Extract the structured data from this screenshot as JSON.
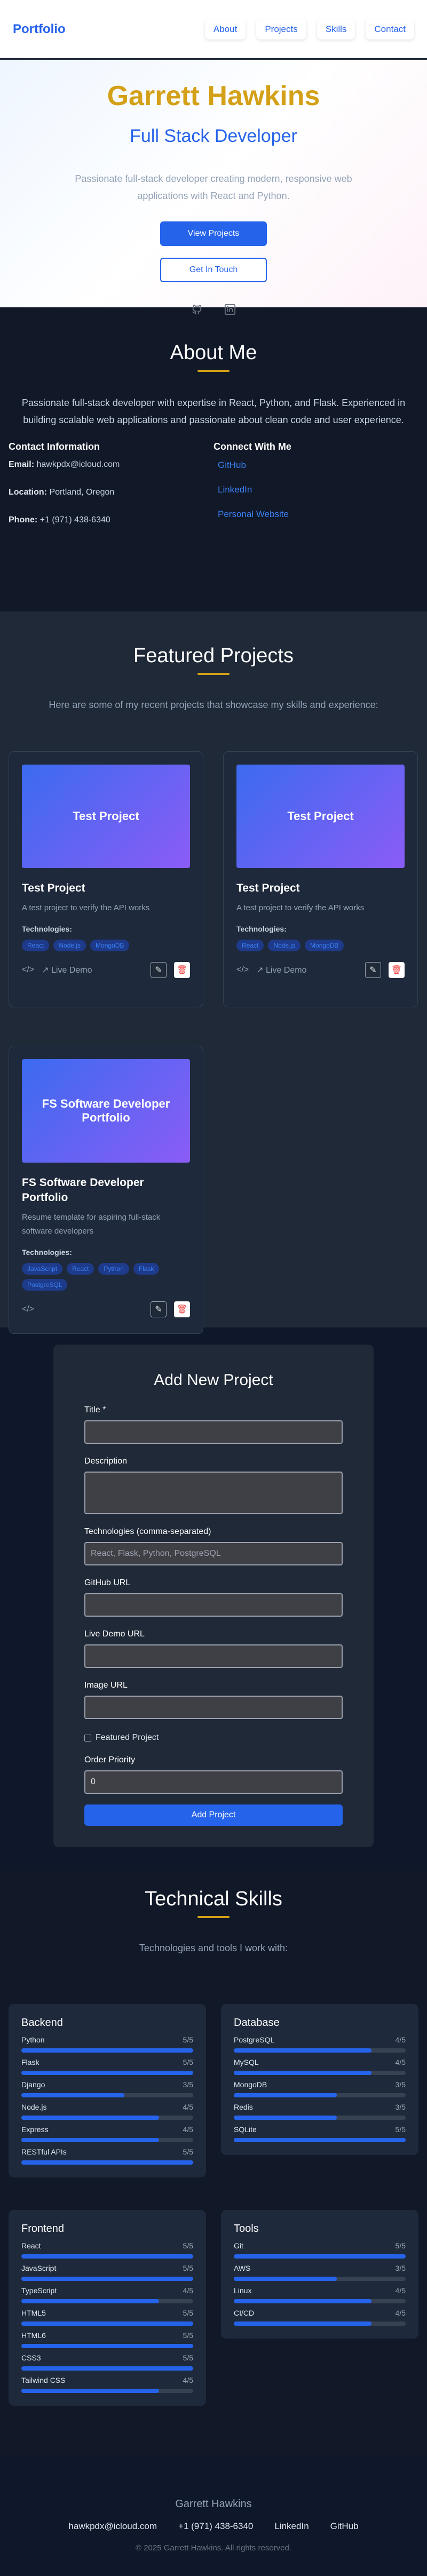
{
  "nav": {
    "logo": "Portfolio",
    "links": [
      "About",
      "Projects",
      "Skills",
      "Contact"
    ]
  },
  "hero": {
    "name": "Garrett Hawkins",
    "role": "Full Stack Developer",
    "tagline": "Passionate full-stack developer creating modern, responsive web applications with React and Python.",
    "view_projects": "View Projects",
    "get_in_touch": "Get In Touch"
  },
  "about": {
    "title": "About Me",
    "lead": "Passionate full-stack developer with expertise in React, Python, and Flask. Experienced in building scalable web applications and passionate about clean code and user experience.",
    "contact_title": "Contact Information",
    "email_label": "Email:",
    "email": "hawkpdx@icloud.com",
    "location_label": "Location:",
    "location": "Portland, Oregon",
    "phone_label": "Phone:",
    "phone": "+1 (971) 438-6340",
    "connect_title": "Connect With Me",
    "connect_links": [
      "GitHub",
      "LinkedIn",
      "Personal Website"
    ]
  },
  "projects": {
    "title": "Featured Projects",
    "subtitle": "Here are some of my recent projects that showcase my skills and experience:",
    "tech_label": "Technologies:",
    "live_demo": "Live Demo",
    "items": [
      {
        "thumb": "Test Project",
        "title": "Test Project",
        "desc": "A test project to verify the API works",
        "tags": [
          "React",
          "Node.js",
          "MongoDB"
        ]
      },
      {
        "thumb": "Test Project",
        "title": "Test Project",
        "desc": "A test project to verify the API works",
        "tags": [
          "React",
          "Node.js",
          "MongoDB"
        ]
      },
      {
        "thumb": "FS Software Developer Portfolio",
        "title": "FS Software Developer Portfolio",
        "desc": "Resume template for aspiring full-stack software developers",
        "tags": [
          "JavaScript",
          "React",
          "Python",
          "Flask",
          "PostgreSQL"
        ]
      }
    ]
  },
  "form": {
    "title": "Add New Project",
    "title_label": "Title *",
    "desc_label": "Description",
    "tech_label": "Technologies (comma-separated)",
    "tech_placeholder": "React, Flask, Python, PostgreSQL",
    "github_label": "GitHub URL",
    "demo_label": "Live Demo URL",
    "image_label": "Image URL",
    "featured_label": "Featured Project",
    "order_label": "Order Priority",
    "order_value": "0",
    "submit": "Add Project"
  },
  "skills": {
    "title": "Technical Skills",
    "subtitle": "Technologies and tools I work with:",
    "groups": [
      {
        "name": "Backend",
        "items": [
          {
            "name": "Python",
            "level": "5/5",
            "value": 5
          },
          {
            "name": "Flask",
            "level": "5/5",
            "value": 5
          },
          {
            "name": "Django",
            "level": "3/5",
            "value": 3
          },
          {
            "name": "Node.js",
            "level": "4/5",
            "value": 4
          },
          {
            "name": "Express",
            "level": "4/5",
            "value": 4
          },
          {
            "name": "RESTful APIs",
            "level": "5/5",
            "value": 5
          }
        ]
      },
      {
        "name": "Database",
        "items": [
          {
            "name": "PostgreSQL",
            "level": "4/5",
            "value": 4
          },
          {
            "name": "MySQL",
            "level": "4/5",
            "value": 4
          },
          {
            "name": "MongoDB",
            "level": "3/5",
            "value": 3
          },
          {
            "name": "Redis",
            "level": "3/5",
            "value": 3
          },
          {
            "name": "SQLite",
            "level": "5/5",
            "value": 5
          }
        ]
      },
      {
        "name": "Frontend",
        "items": [
          {
            "name": "React",
            "level": "5/5",
            "value": 5
          },
          {
            "name": "JavaScript",
            "level": "5/5",
            "value": 5
          },
          {
            "name": "TypeScript",
            "level": "4/5",
            "value": 4
          },
          {
            "name": "HTML5",
            "level": "5/5",
            "value": 5
          },
          {
            "name": "HTML6",
            "level": "5/5",
            "value": 5
          },
          {
            "name": "CSS3",
            "level": "5/5",
            "value": 5
          },
          {
            "name": "Tailwind CSS",
            "level": "4/5",
            "value": 4
          }
        ]
      },
      {
        "name": "Tools",
        "items": [
          {
            "name": "Git",
            "level": "5/5",
            "value": 5
          },
          {
            "name": "AWS",
            "level": "3/5",
            "value": 3
          },
          {
            "name": "Linux",
            "level": "4/5",
            "value": 4
          },
          {
            "name": "CI/CD",
            "level": "4/5",
            "value": 4
          }
        ]
      }
    ]
  },
  "footer": {
    "name": "Garrett Hawkins",
    "email": "hawkpdx@icloud.com",
    "phone": "+1 (971) 438-6340",
    "linkedin": "LinkedIn",
    "github": "GitHub",
    "copyright": "© 2025 Garrett Hawkins. All rights reserved."
  },
  "colors": {
    "accent": "#2563eb",
    "gold": "#d4a017",
    "bg_dark": "#0f172a"
  }
}
